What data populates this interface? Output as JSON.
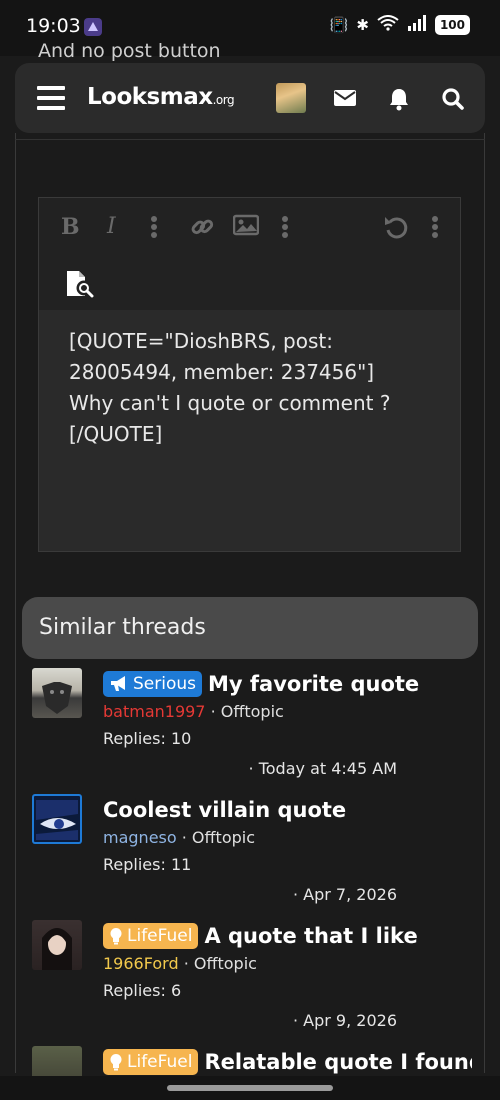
{
  "status_bar": {
    "time": "19:03",
    "battery": "100"
  },
  "behind_text": "And no post button",
  "header": {
    "logo_main": "Looksmax",
    "logo_suffix": ".org"
  },
  "editor": {
    "content": "[QUOTE=\"DioshBRS, post:\n28005494, member: 237456\"]\nWhy can't I quote or comment ?\n[/QUOTE]"
  },
  "similar": {
    "heading": "Similar threads",
    "threads": [
      {
        "label": "Serious",
        "title": "My favorite quote",
        "user": "batman1997",
        "forum": "Offtopic",
        "replies": "Replies: 10",
        "date": "Today at 4:45 AM"
      },
      {
        "label": "",
        "title": "Coolest villain quote",
        "user": "magneso",
        "forum": "Offtopic",
        "replies": "Replies: 11",
        "date": "Apr 7, 2026"
      },
      {
        "label": "LifeFuel",
        "title": "A quote that I like",
        "user": "1966Ford",
        "forum": "Offtopic",
        "replies": "Replies: 6",
        "date": "Apr 9, 2026"
      },
      {
        "label": "LifeFuel",
        "title": "Relatable quote I found",
        "user": "",
        "forum": "",
        "replies": "",
        "date": ""
      }
    ]
  },
  "colors": {
    "serious": "#1e7ad6",
    "lifefuel": "#f6b54f",
    "user_red": "#e53935",
    "user_blue": "#8fb4e3",
    "user_gold": "#f2c94c"
  },
  "icons": [
    "hamburger-icon",
    "mail-icon",
    "bell-icon",
    "search-icon",
    "bold-icon",
    "italic-icon",
    "link-icon",
    "image-icon",
    "undo-icon",
    "more-icon",
    "preview-icon",
    "megaphone-icon",
    "bulb-icon"
  ]
}
